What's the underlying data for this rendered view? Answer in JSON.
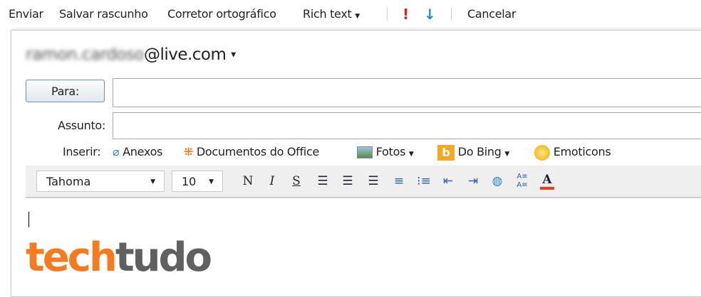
{
  "toolbar": {
    "send": "Enviar",
    "save_draft": "Salvar rascunho",
    "spellcheck": "Corretor ortográfico",
    "rich_text": "Rich text",
    "cancel": "Cancelar"
  },
  "sender": {
    "name_blurred": "ramon.cardoso",
    "domain": "@live.com"
  },
  "to": {
    "label": "Para:",
    "value": ""
  },
  "subject": {
    "label": "Assunto:",
    "value": ""
  },
  "insert": {
    "label": "Inserir:",
    "attachments": "Anexos",
    "office": "Documentos do Office",
    "photos": "Fotos",
    "bing": "Do Bing",
    "emoticons": "Emoticons"
  },
  "format": {
    "font": "Tahoma",
    "size": "10",
    "bold": "N",
    "italic": "I",
    "underline": "S"
  },
  "logo": {
    "part1": "tech",
    "part2": "tudo"
  },
  "colors": {
    "accent_orange": "#f47b20",
    "logo_gray": "#606060",
    "priority_red": "#e02020",
    "priority_blue": "#2b86d8"
  }
}
